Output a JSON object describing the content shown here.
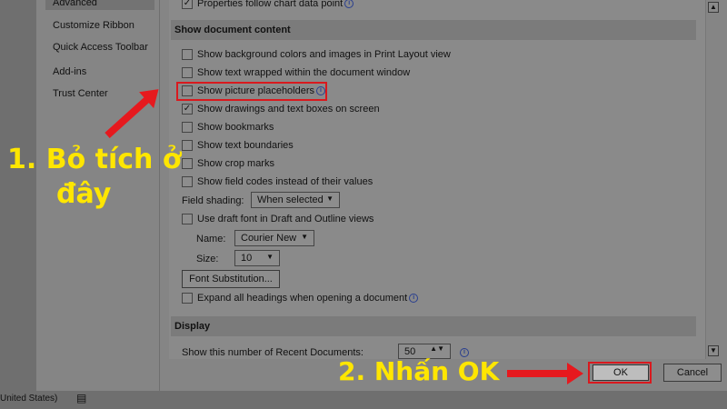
{
  "nav": {
    "items": [
      "Advanced",
      "Customize Ribbon",
      "Quick Access Toolbar",
      "Add-ins",
      "Trust Center"
    ]
  },
  "top_row": {
    "label": "Properties follow chart data point"
  },
  "section_show": {
    "title": "Show document content",
    "options": [
      {
        "label": "Show background colors and images in Print Layout view",
        "checked": false
      },
      {
        "label": "Show text wrapped within the document window",
        "checked": false
      },
      {
        "label": "Show picture placeholders",
        "checked": false
      },
      {
        "label": "Show drawings and text boxes on screen",
        "checked": true
      },
      {
        "label": "Show bookmarks",
        "checked": false
      },
      {
        "label": "Show text boundaries",
        "checked": false
      },
      {
        "label": "Show crop marks",
        "checked": false
      },
      {
        "label": "Show field codes instead of their values",
        "checked": false
      }
    ],
    "field_shading_label": "Field shading:",
    "field_shading_value": "When selected",
    "draft_font_label": "Use draft font in Draft and Outline views",
    "name_label": "Name:",
    "name_value": "Courier New",
    "size_label": "Size:",
    "size_value": "10",
    "font_sub_button": "Font Substitution...",
    "expand_label": "Expand all headings when opening a document"
  },
  "section_display": {
    "title": "Display",
    "recent_docs_label": "Show this number of Recent Documents:",
    "recent_docs_value": "50"
  },
  "buttons": {
    "ok": "OK",
    "cancel": "Cancel"
  },
  "status": {
    "language": "United States)"
  },
  "annotations": {
    "step1_line1": "1. Bỏ tích ở",
    "step1_line2": "đây",
    "step2": "2. Nhấn OK"
  },
  "colors": {
    "annotation": "#ffe600",
    "arrow": "#e6191e",
    "highlight": "#d9191e"
  }
}
